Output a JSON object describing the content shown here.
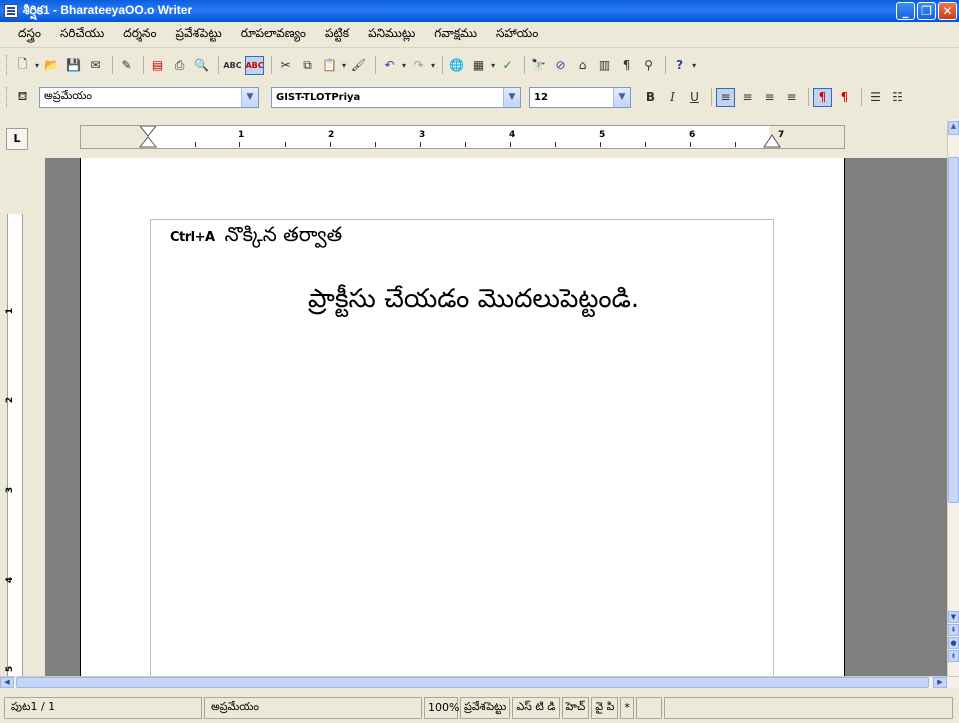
{
  "window": {
    "title": "శీర్షిక1 - BharateeyaOO.o Writer"
  },
  "menu": {
    "items": [
      "దస్త్రం",
      "సరిచేయు",
      "దర్శనం",
      "ప్రవేశపెట్టు",
      "రూపలావణ్యం",
      "పట్టిక",
      "పనిముట్లు",
      "గవాక్షము",
      "సహాయం"
    ]
  },
  "toolbar2": {
    "style": "అప్రమేయం",
    "font": "GIST-TLOTPriya",
    "size": "12",
    "bold": "B",
    "italic": "I",
    "underline": "U"
  },
  "ruler": {
    "numbers": [
      "1",
      "2",
      "3",
      "4",
      "5",
      "6",
      "7"
    ],
    "vertical_numbers": [
      "1",
      "2",
      "3",
      "4",
      "5"
    ],
    "tab_stop": "L"
  },
  "document": {
    "line1_shortcut": "Ctrl+A",
    "line1_text": "నొక్కిన తర్వాత",
    "line2_text": "ప్రాక్టీసు చేయడం మొదలుపెట్టండి."
  },
  "status": {
    "page": "పుట1 / 1",
    "style": "అప్రమేయం",
    "zoom": "100%",
    "insert_mode": "ప్రవేశపెట్టు",
    "selection_mode": "ఎస్ టి డి",
    "hyperlink_mode": "హెచ్",
    "layout": "వై పి",
    "modified": "*"
  }
}
